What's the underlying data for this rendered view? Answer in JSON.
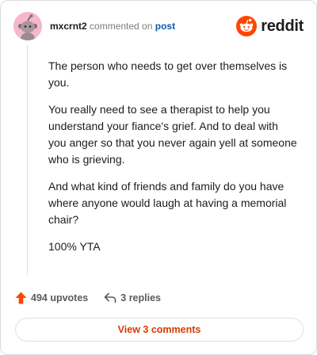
{
  "header": {
    "username": "mxcrnt2",
    "action_text": "commented on",
    "post_link": "post",
    "logo_text": "reddit"
  },
  "comment": {
    "paragraphs": [
      "The person who needs to get over themselves is you.",
      "You really need to see a therapist to help you understand your fiance's grief. And to deal with you anger so that you never again yell at someone who is grieving.",
      "And what kind of friends and family do you have where anyone would laugh at having a memorial chair?",
      "100% YTA"
    ]
  },
  "actions": {
    "upvotes": "494 upvotes",
    "replies": "3 replies",
    "view_comments": "View 3 comments"
  },
  "colors": {
    "reddit_orange": "#ff4500",
    "link_blue": "#0a5ca8",
    "avatar_pink": "#f5b8c8",
    "button_text": "#d93a00"
  },
  "icons": [
    "snoo-avatar-icon",
    "reddit-logo-icon",
    "upvote-arrow-icon",
    "reply-arrow-icon"
  ]
}
